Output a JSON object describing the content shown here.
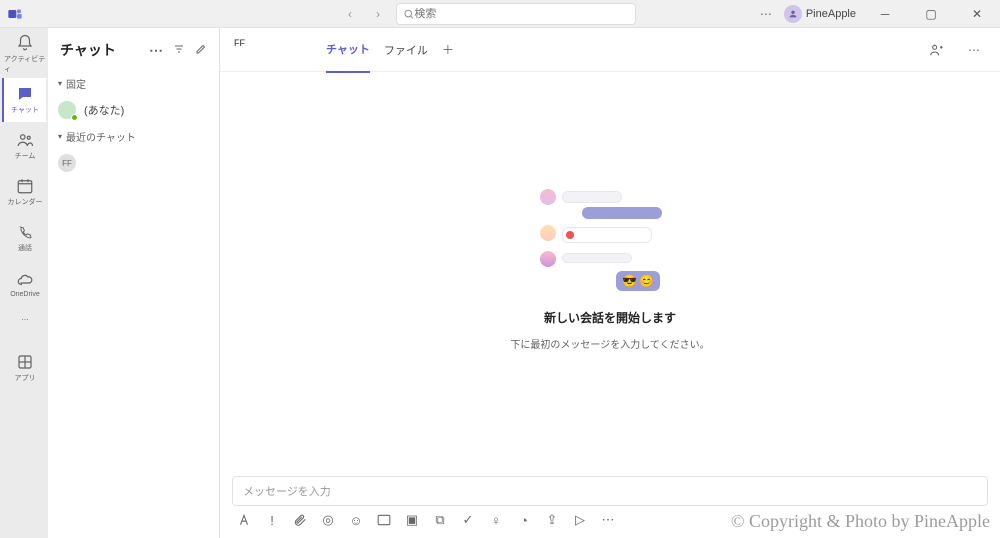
{
  "titlebar": {
    "search_placeholder": "検索",
    "username": "PineApple"
  },
  "rail": [
    {
      "id": "activity",
      "label": "アクティビティ"
    },
    {
      "id": "chat",
      "label": "チャット",
      "active": true
    },
    {
      "id": "teams",
      "label": "チーム"
    },
    {
      "id": "calendar",
      "label": "カレンダー"
    },
    {
      "id": "calls",
      "label": "通話"
    },
    {
      "id": "onedrive",
      "label": "OneDrive"
    }
  ],
  "rail_apps_label": "アプリ",
  "chatlist": {
    "title": "チャット",
    "pinned_label": "固定",
    "recent_label": "最近のチャット",
    "self_label": "(あなた)",
    "recent_initials": "FF"
  },
  "chatheader": {
    "avatar_initials": "FF",
    "tab_chat": "チャット",
    "tab_file": "ファイル"
  },
  "empty": {
    "title": "新しい会話を開始します",
    "subtitle": "下に最初のメッセージを入力してください。"
  },
  "compose": {
    "placeholder": "メッセージを入力"
  },
  "watermark": "© Copyright & Photo by PineApple"
}
